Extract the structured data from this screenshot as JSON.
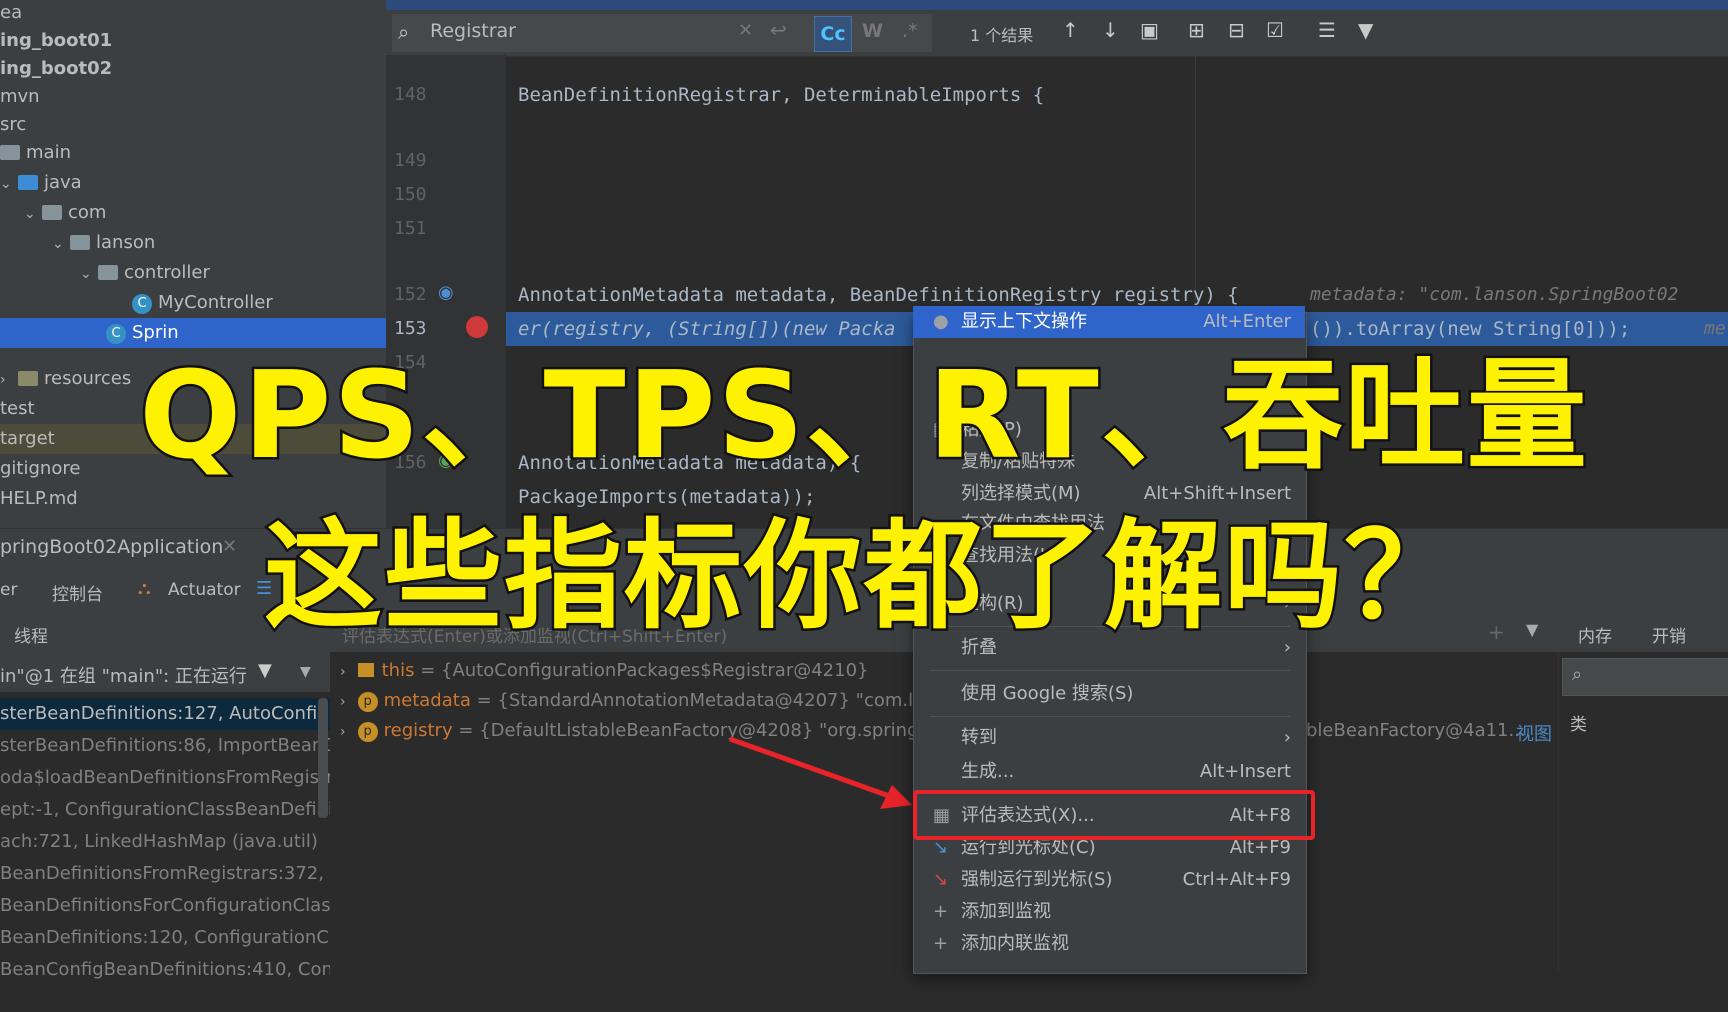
{
  "project_tree": [
    {
      "label": "ea",
      "type": "text"
    },
    {
      "label": "ing_boot01",
      "type": "text",
      "bold": true
    },
    {
      "label": "ing_boot02",
      "type": "text",
      "bold": true
    },
    {
      "label": "mvn",
      "type": "text"
    },
    {
      "label": "src",
      "type": "text"
    },
    {
      "label": "main",
      "type": "folder"
    },
    {
      "label": "java",
      "type": "folder-blue"
    },
    {
      "label": "com",
      "type": "folder"
    },
    {
      "label": "lanson",
      "type": "folder"
    },
    {
      "label": "controller",
      "type": "folder"
    },
    {
      "label": "MyController",
      "type": "class"
    },
    {
      "label": "Sprin",
      "type": "class-selected"
    },
    {
      "label": "resources",
      "type": "folder-res"
    },
    {
      "label": "test",
      "type": "text"
    },
    {
      "label": "target",
      "type": "target"
    },
    {
      "label": "gitignore",
      "type": "text"
    },
    {
      "label": "HELP.md",
      "type": "text"
    }
  ],
  "search": {
    "query": "Registrar",
    "case_btn": "Cc",
    "word_btn": "W",
    "regex_btn": ".*",
    "results": "1 个结果"
  },
  "editor": {
    "lines": [
      {
        "num": "148",
        "code": "BeanDefinitionRegistrar, DeterminableImports {"
      },
      {
        "num": "149",
        "code": ""
      },
      {
        "num": "150",
        "code": ""
      },
      {
        "num": "151",
        "code": ""
      },
      {
        "num": "152",
        "code": "AnnotationMetadata metadata, BeanDefinitionRegistry registry) {"
      },
      {
        "num": "153",
        "code": "er(registry, (String[])(new Packa"
      },
      {
        "num": "154",
        "code": ""
      },
      {
        "num": "156",
        "code": "AnnotationMetadata metadata) {"
      },
      {
        "num": "157",
        "code": "PackageImports(metadata));"
      }
    ],
    "hint_152": "metadata: \"com.lanson.SpringBoot02",
    "tail_153": "()).toArray(new String[0]));",
    "tail_153b": "me"
  },
  "debug": {
    "tab_label": "pringBoot02Application",
    "tabs": [
      "er",
      "控制台",
      "Actuator"
    ],
    "frames_header": "线程",
    "eval_placeholder": "评估表达式(Enter)或添加监视(Ctrl+Shift+Enter)",
    "thread_status": "in\"@1 在组 \"main\": 正在运行",
    "frames": [
      "sterBeanDefinitions:127, AutoConfigu",
      "sterBeanDefinitions:86, ImportBeanDe",
      "oda$loadBeanDefinitionsFromRegistra",
      "ept:-1, ConfigurationClassBeanDefinitio",
      "ach:721, LinkedHashMap (java.util)",
      "BeanDefinitionsFromRegistrars:372, C",
      "BeanDefinitionsForConfigurationClass",
      "BeanDefinitions:120, ConfigurationCla",
      "BeanConfigBeanDefinitions:410, Config"
    ],
    "vars": [
      {
        "badge": "",
        "name": "this",
        "value": "{AutoConfigurationPackages$Registrar@4210}"
      },
      {
        "badge": "p",
        "name": "metadata",
        "value": "{StandardAnnotationMetadata@4207} \"com.la"
      },
      {
        "badge": "p",
        "name": "registry",
        "value": "{DefaultListableBeanFactory@4208} \"org.springf"
      }
    ],
    "registry_tail": "bleBeanFactory@4a11...",
    "view_link": "视图",
    "right_tabs": [
      "内存",
      "开销"
    ],
    "right_col": "类"
  },
  "context_menu": {
    "items": [
      {
        "label": "显示上下文操作",
        "shortcut": "Alt+Enter",
        "highlight": true
      },
      {
        "label": "粘贴(P)",
        "shortcut": ""
      },
      {
        "label": "复制/粘贴特殊",
        "shortcut": "",
        "submenu": true
      },
      {
        "label": "列选择模式(M)",
        "shortcut": "Alt+Shift+Insert"
      },
      {
        "label": "在文件中查找用法",
        "shortcut": ""
      },
      {
        "label": "查找用法(U)",
        "shortcut": ""
      },
      {
        "label": "重构(R)",
        "shortcut": "",
        "submenu": true
      },
      {
        "label": "折叠",
        "shortcut": "",
        "submenu": true
      },
      {
        "label": "使用 Google 搜索(S)",
        "shortcut": ""
      },
      {
        "label": "转到",
        "shortcut": "",
        "submenu": true
      },
      {
        "label": "生成...",
        "shortcut": "Alt+Insert"
      },
      {
        "label": "评估表达式(X)...",
        "shortcut": "Alt+F8"
      },
      {
        "label": "运行到光标处(C)",
        "shortcut": "Alt+F9"
      },
      {
        "label": "强制运行到光标(S)",
        "shortcut": "Ctrl+Alt+F9"
      },
      {
        "label": "添加到监视",
        "shortcut": ""
      },
      {
        "label": "添加内联监视",
        "shortcut": ""
      }
    ]
  },
  "overlay": {
    "line1": "QPS、TPS、RT、吞吐量",
    "line2": "这些指标你都了解吗？"
  },
  "colors": {
    "accent_highlight": "#2f65ca",
    "callout_red": "#e8232a",
    "title_yellow": "#fff200"
  }
}
